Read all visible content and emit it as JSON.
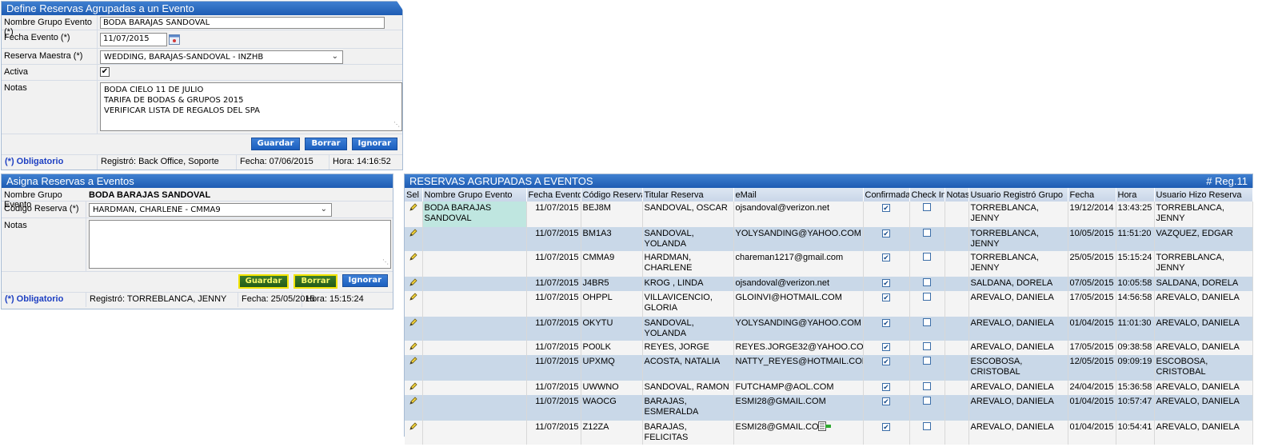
{
  "panel1": {
    "title": "Define Reservas Agrupadas a un Evento",
    "fields": {
      "nombre_label": "Nombre Grupo Evento (*)",
      "nombre_value": "BODA BARAJAS SANDOVAL",
      "fecha_label": "Fecha Evento (*)",
      "fecha_value": "11/07/2015",
      "reserva_label": "Reserva Maestra (*)",
      "reserva_value": "WEDDING, BARAJAS-SANDOVAL - INZHB",
      "activa_label": "Activa",
      "notas_label": "Notas",
      "notas_lines": [
        "BODA CIELO 11 DE JULIO",
        "TARIFA DE BODAS & GRUPOS 2015",
        "VERIFICAR LISTA DE REGALOS DEL SPA"
      ]
    },
    "buttons": {
      "guardar": "Guardar",
      "borrar": "Borrar",
      "ignorar": "Ignorar"
    },
    "footer": {
      "obligatorio": "(*) Obligatorio",
      "registro": "Registró: Back Office, Soporte",
      "fecha": "Fecha:  07/06/2015",
      "hora": "Hora:  14:16:52"
    }
  },
  "panel2": {
    "title": "Asigna Reservas a Eventos",
    "fields": {
      "nombre_label": "Nombre Grupo Evento",
      "nombre_value": "BODA BARAJAS SANDOVAL",
      "codigo_label": "Código Reserva (*)",
      "codigo_value": "HARDMAN, CHARLENE - CMMA9",
      "notas_label": "Notas"
    },
    "buttons": {
      "guardar": "Guardar",
      "borrar": "Borrar",
      "ignorar": "Ignorar"
    },
    "footer": {
      "obligatorio": "(*) Obligatorio",
      "registro": "Registró: TORREBLANCA, JENNY",
      "fecha": "Fecha: 25/05/2015",
      "hora": "Hora: 15:15:24"
    }
  },
  "grid": {
    "title": "RESERVAS AGRUPADAS A EVENTOS",
    "reg_count": "# Reg.11",
    "columns": [
      "Sel",
      "Nombre Grupo Evento",
      "Fecha Evento",
      "Código Reserva",
      "Titular Reserva",
      "eMail",
      "Confirmada",
      "Check In",
      "Notas",
      "Usuario Registró Grupo",
      "Fecha",
      "Hora",
      "Usuario Hizo Reserva"
    ],
    "rows": [
      {
        "grupo": "BODA BARAJAS SANDOVAL",
        "fecha_evento": "11/07/2015",
        "codigo": "BEJ8M",
        "titular": "SANDOVAL, OSCAR",
        "email": "ojsandoval@verizon.net",
        "confirmada": true,
        "checkin": false,
        "notas": "",
        "usuario_grupo": "TORREBLANCA, JENNY",
        "fecha": "19/12/2014",
        "hora": "13:43:25",
        "usuario_reserva": "TORREBLANCA, JENNY"
      },
      {
        "grupo": "",
        "fecha_evento": "11/07/2015",
        "codigo": "BM1A3",
        "titular": "SANDOVAL, YOLANDA",
        "email": "YOLYSANDING@YAHOO.COM",
        "confirmada": true,
        "checkin": false,
        "notas": "",
        "usuario_grupo": "TORREBLANCA, JENNY",
        "fecha": "10/05/2015",
        "hora": "11:51:20",
        "usuario_reserva": "VAZQUEZ, EDGAR"
      },
      {
        "grupo": "",
        "fecha_evento": "11/07/2015",
        "codigo": "CMMA9",
        "titular": "HARDMAN, CHARLENE",
        "email": "chareman1217@gmail.com",
        "confirmada": true,
        "checkin": false,
        "notas": "",
        "usuario_grupo": "TORREBLANCA, JENNY",
        "fecha": "25/05/2015",
        "hora": "15:15:24",
        "usuario_reserva": "TORREBLANCA, JENNY"
      },
      {
        "grupo": "",
        "fecha_evento": "11/07/2015",
        "codigo": "J4BR5",
        "titular": "KROG , LINDA",
        "email": "ojsandoval@verizon.net",
        "confirmada": true,
        "checkin": false,
        "notas": "",
        "usuario_grupo": "SALDANA, DORELA",
        "fecha": "07/05/2015",
        "hora": "10:05:58",
        "usuario_reserva": "SALDANA, DORELA"
      },
      {
        "grupo": "",
        "fecha_evento": "11/07/2015",
        "codigo": "OHPPL",
        "titular": "VILLAVICENCIO, GLORIA",
        "email": "GLOINVI@HOTMAIL.COM",
        "confirmada": true,
        "checkin": false,
        "notas": "",
        "usuario_grupo": "AREVALO, DANIELA",
        "fecha": "17/05/2015",
        "hora": "14:56:58",
        "usuario_reserva": "AREVALO, DANIELA"
      },
      {
        "grupo": "",
        "fecha_evento": "11/07/2015",
        "codigo": "OKYTU",
        "titular": "SANDOVAL, YOLANDA",
        "email": "YOLYSANDING@YAHOO.COM",
        "confirmada": true,
        "checkin": false,
        "notas": "",
        "usuario_grupo": "AREVALO, DANIELA",
        "fecha": "01/04/2015",
        "hora": "11:01:30",
        "usuario_reserva": "AREVALO, DANIELA"
      },
      {
        "grupo": "",
        "fecha_evento": "11/07/2015",
        "codigo": "PO0LK",
        "titular": "REYES, JORGE",
        "email": "REYES.JORGE32@YAHOO.COM",
        "confirmada": true,
        "checkin": false,
        "notas": "",
        "usuario_grupo": "AREVALO, DANIELA",
        "fecha": "17/05/2015",
        "hora": "09:38:58",
        "usuario_reserva": "AREVALO, DANIELA"
      },
      {
        "grupo": "",
        "fecha_evento": "11/07/2015",
        "codigo": "UPXMQ",
        "titular": "ACOSTA, NATALIA",
        "email": "NATTY_REYES@HOTMAIL.COM",
        "confirmada": true,
        "checkin": false,
        "notas": "",
        "usuario_grupo": "ESCOBOSA, CRISTOBAL",
        "fecha": "12/05/2015",
        "hora": "09:09:19",
        "usuario_reserva": "ESCOBOSA, CRISTOBAL"
      },
      {
        "grupo": "",
        "fecha_evento": "11/07/2015",
        "codigo": "UWWNO",
        "titular": "SANDOVAL, RAMON",
        "email": "FUTCHAMP@AOL.COM",
        "confirmada": true,
        "checkin": false,
        "notas": "",
        "usuario_grupo": "AREVALO, DANIELA",
        "fecha": "24/04/2015",
        "hora": "15:36:58",
        "usuario_reserva": "AREVALO, DANIELA"
      },
      {
        "grupo": "",
        "fecha_evento": "11/07/2015",
        "codigo": "WAOCG",
        "titular": "BARAJAS, ESMERALDA",
        "email": "ESMI28@GMAIL.COM",
        "confirmada": true,
        "checkin": false,
        "notas": "",
        "usuario_grupo": "AREVALO, DANIELA",
        "fecha": "01/04/2015",
        "hora": "10:57:47",
        "usuario_reserva": "AREVALO, DANIELA"
      },
      {
        "grupo": "",
        "fecha_evento": "11/07/2015",
        "codigo": "Z12ZA",
        "titular": "BARAJAS, FELICITAS",
        "email": "ESMI28@GMAIL.COM",
        "confirmada": true,
        "checkin": false,
        "notas": "",
        "usuario_grupo": "AREVALO, DANIELA",
        "fecha": "01/04/2015",
        "hora": "10:54:41",
        "usuario_reserva": "AREVALO, DANIELA"
      }
    ]
  }
}
